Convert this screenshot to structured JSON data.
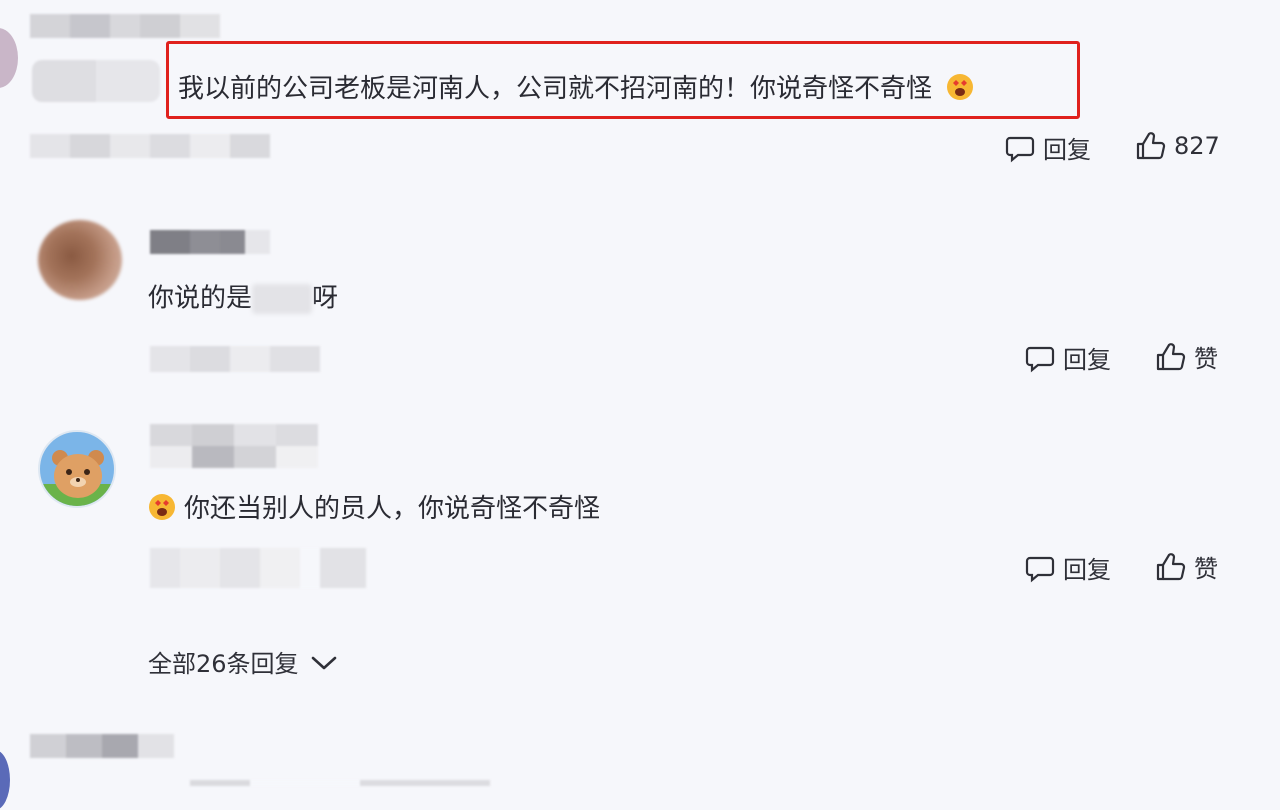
{
  "comment_main": {
    "text": "我以前的公司老板是河南人，公司就不招河南的！你说奇怪不奇怪",
    "reply_label": "回复",
    "like_count": "827",
    "highlight_color": "#e0211d"
  },
  "replies": [
    {
      "text_before": "你说的是",
      "text_after": "呀",
      "reply_label": "回复",
      "like_label": "赞"
    },
    {
      "text": "你还当别人的员人，你说奇怪不奇怪",
      "reply_label": "回复",
      "like_label": "赞"
    }
  ],
  "expand": {
    "label": "全部26条回复"
  },
  "icons": {
    "comment": "speech-bubble-icon",
    "like": "thumbs-up-icon",
    "expand": "chevron-down-icon",
    "emoji": "heart-eyes-emoji-icon"
  }
}
